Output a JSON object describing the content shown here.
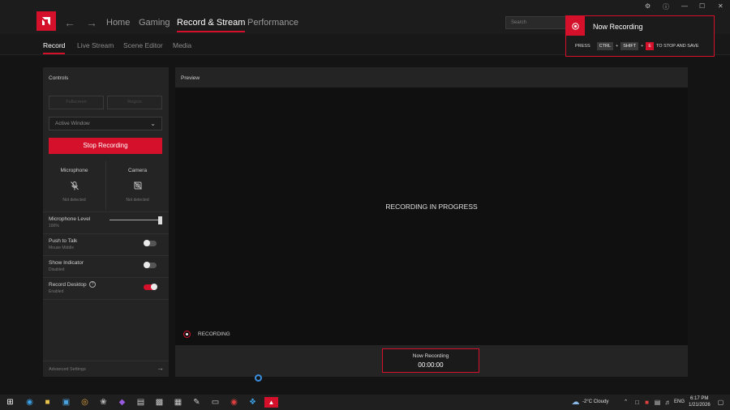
{
  "topnav": {
    "tabs": [
      "Home",
      "Gaming",
      "Record & Stream",
      "Performance"
    ],
    "active": "Record & Stream",
    "search_placeholder": "Search"
  },
  "subnav": {
    "tabs": [
      "Record",
      "Live Stream",
      "Scene Editor",
      "Media"
    ],
    "active": "Record"
  },
  "controls": {
    "title": "Controls",
    "buttons": [
      "Fullscreen",
      "Region"
    ],
    "capture_mode": "Active Window",
    "stop_label": "Stop Recording",
    "microphone": {
      "label": "Microphone",
      "status": "Not detected"
    },
    "camera": {
      "label": "Camera",
      "status": "Not detected"
    },
    "mic_level": {
      "label": "Microphone Level",
      "value": "100%",
      "fraction": 1.0
    },
    "push_to_talk": {
      "label": "Push to Talk",
      "sub": "Mouse Middle",
      "on": false
    },
    "show_indicator": {
      "label": "Show Indicator",
      "sub": "Disabled",
      "on": false
    },
    "record_desktop": {
      "label": "Record Desktop",
      "sub": "Enabled",
      "on": true
    },
    "advanced": "Advanced Settings"
  },
  "preview": {
    "title": "Preview",
    "status": "RECORDING IN PROGRESS",
    "indicator": "RECORDING",
    "timer_label": "Now Recording",
    "timer_value": "00:00:00"
  },
  "notification": {
    "title": "Now Recording",
    "press": "PRESS",
    "keys": [
      "CTRL",
      "SHIFT",
      "E"
    ],
    "plus": "+",
    "suffix": "TO STOP AND SAVE"
  },
  "taskbar": {
    "weather": "-2°C  Cloudy",
    "lang": "ENG",
    "time": "6:17 PM",
    "date": "1/21/2026"
  },
  "colors": {
    "accent": "#d4102a",
    "background": "#141414",
    "panel": "#242424"
  }
}
